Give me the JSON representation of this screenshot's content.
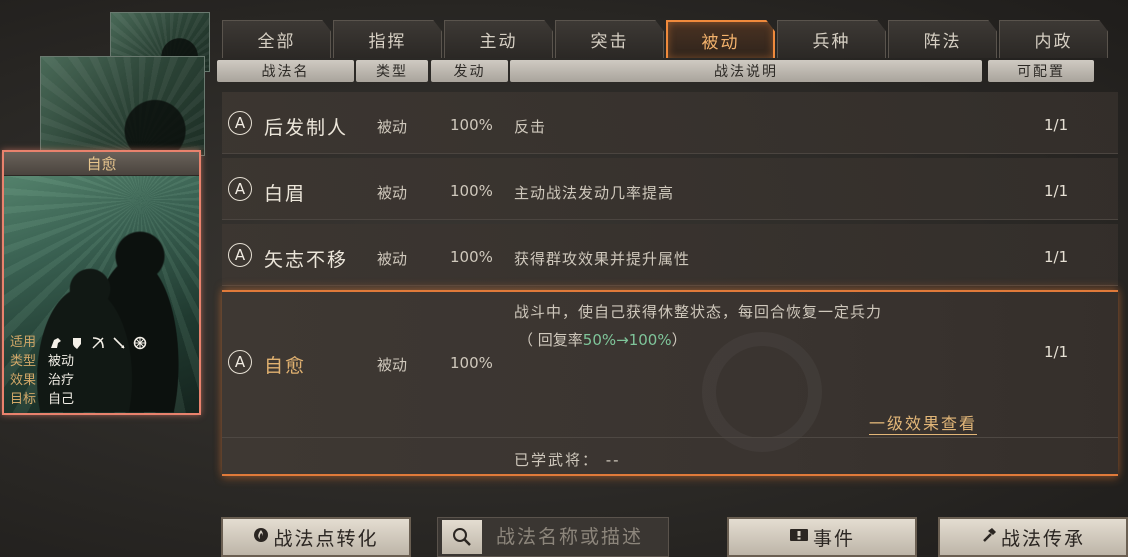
{
  "card": {
    "title": "自愈",
    "applicable_label": "适用",
    "unit_icons": [
      "cavalry-icon",
      "shield-icon",
      "bow-icon",
      "spear-icon",
      "wheel-icon"
    ],
    "type_label": "类型",
    "type_value": "被动",
    "effect_label": "效果",
    "effect_value": "治疗",
    "target_label": "目标",
    "target_value": "自己"
  },
  "tabs": [
    {
      "label": "全部",
      "active": false
    },
    {
      "label": "指挥",
      "active": false
    },
    {
      "label": "主动",
      "active": false
    },
    {
      "label": "突击",
      "active": false
    },
    {
      "label": "被动",
      "active": true
    },
    {
      "label": "兵种",
      "active": false
    },
    {
      "label": "阵法",
      "active": false
    },
    {
      "label": "内政",
      "active": false
    }
  ],
  "columns": {
    "name": "战法名",
    "type": "类型",
    "rate": "发动",
    "desc": "战法说明",
    "config": "可配置"
  },
  "rows": [
    {
      "grade": "A",
      "name": "后发制人",
      "type": "被动",
      "rate": "100%",
      "desc": "反击",
      "config": "1/1"
    },
    {
      "grade": "A",
      "name": "白眉",
      "type": "被动",
      "rate": "100%",
      "desc": "主动战法发动几率提高",
      "config": "1/1"
    },
    {
      "grade": "A",
      "name": "矢志不移",
      "type": "被动",
      "rate": "100%",
      "desc": "获得群攻效果并提升属性",
      "config": "1/1"
    }
  ],
  "expanded": {
    "grade": "A",
    "name": "自愈",
    "type": "被动",
    "rate": "100%",
    "desc_line1": "战斗中，使自己获得休整状态，每回合恢复一定兵力",
    "desc_line2_prefix": "（ 回复率",
    "desc_line2_highlight": "50%→100%",
    "desc_line2_suffix": "）",
    "config": "1/1",
    "link": "一级效果查看",
    "learned": "已学武将：  --"
  },
  "bottom": {
    "convert_button": "战法点转化",
    "search_placeholder": "战法名称或描述",
    "event_button": "事件",
    "inherit_button": "战法传承"
  }
}
